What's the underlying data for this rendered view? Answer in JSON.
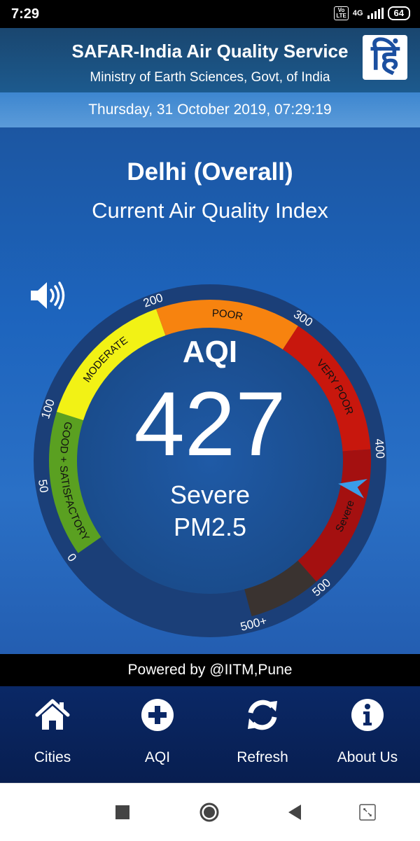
{
  "status_bar": {
    "time": "7:29",
    "volte_line1": "Vo",
    "volte_line2": "LTE",
    "network": "4G",
    "battery": "64"
  },
  "header": {
    "title": "SAFAR-India Air Quality Service",
    "subtitle": "Ministry of Earth Sciences, Govt, of India",
    "hindi_button": "हिं"
  },
  "date_time": "Thursday, 31 October 2019, 07:29:19",
  "location": {
    "city": "Delhi (Overall)",
    "subtitle": "Current Air Quality Index"
  },
  "aqi": {
    "label": "AQI",
    "value": 427,
    "value_text": "427",
    "category": "Severe",
    "pollutant": "PM2.5",
    "scale_max": 550
  },
  "gauge": {
    "bands": [
      {
        "name": "GOOD + SATISFACTORY",
        "from": 0,
        "to": 100,
        "color": "#5aa021",
        "text_color": "#111111"
      },
      {
        "name": "MODERATE",
        "from": 100,
        "to": 200,
        "color": "#f2f215",
        "text_color": "#111111"
      },
      {
        "name": "POOR",
        "from": 200,
        "to": 300,
        "color": "#f7830f",
        "text_color": "#111111"
      },
      {
        "name": "VERY POOR",
        "from": 300,
        "to": 400,
        "color": "#c8170d",
        "text_color": "#111111"
      },
      {
        "name": "Severe",
        "from": 400,
        "to": 500,
        "color": "#a41010",
        "text_color": "#111111"
      },
      {
        "name": "",
        "from": 500,
        "to": 550,
        "color": "#3a3330",
        "text_color": "#ffffff"
      }
    ],
    "ticks": [
      {
        "value": 0,
        "label": "0"
      },
      {
        "value": 50,
        "label": "50"
      },
      {
        "value": 100,
        "label": "100"
      },
      {
        "value": 200,
        "label": "200"
      },
      {
        "value": 300,
        "label": "300"
      },
      {
        "value": 400,
        "label": "400"
      },
      {
        "value": 500,
        "label": "500"
      },
      {
        "value": 550,
        "label": "500+"
      }
    ],
    "needle_color": "#3a9ce8"
  },
  "speaker_icon": "speaker-volume-icon",
  "powered_by": "Powered by @IITM,Pune",
  "bottom_nav": [
    {
      "label": "Cities",
      "icon": "home-icon"
    },
    {
      "label": "AQI",
      "icon": "plus-circle-icon"
    },
    {
      "label": "Refresh",
      "icon": "refresh-icon"
    },
    {
      "label": "About Us",
      "icon": "info-circle-icon"
    }
  ]
}
